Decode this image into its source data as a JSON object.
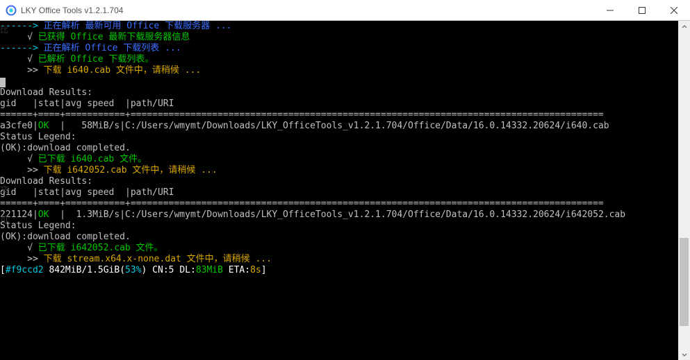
{
  "window": {
    "title": "LKY Office Tools v1.2.1.704"
  },
  "left_edge": {
    "t1": "比",
    "t2": "文",
    "t3": "可"
  },
  "scrollbar": {
    "thumb_top_pct": 65,
    "thumb_height_pct": 28
  },
  "lines": [
    [
      {
        "cls": "c-cyan",
        "t": "------> "
      },
      {
        "cls": "c-blue",
        "t": "正在解析 最新可用 Office 下载服务器 ..."
      }
    ],
    [
      {
        "cls": "c-white",
        "t": "     √ "
      },
      {
        "cls": "c-green",
        "t": "已获得 Office 最新下载服务器信息"
      }
    ],
    [
      {
        "cls": "",
        "t": ""
      }
    ],
    [
      {
        "cls": "c-cyan",
        "t": "------> "
      },
      {
        "cls": "c-blue",
        "t": "正在解析 Office 下载列表 ..."
      }
    ],
    [
      {
        "cls": "c-white",
        "t": "     √ "
      },
      {
        "cls": "c-green",
        "t": "已解析 Office 下载列表。"
      }
    ],
    [
      {
        "cls": "",
        "t": ""
      }
    ],
    [
      {
        "cls": "c-white",
        "t": "     >> "
      },
      {
        "cls": "c-yellow",
        "t": "下载 i640.cab 文件中，请稍候 ..."
      }
    ],
    [
      {
        "cls": "",
        "t": ""
      },
      {
        "cursor": true
      }
    ],
    [
      {
        "cls": "c-gray",
        "t": "Download Results:"
      }
    ],
    [
      {
        "cls": "c-gray",
        "t": "gid   |stat|avg speed  |path/URI"
      }
    ],
    [
      {
        "cls": "c-gray",
        "t": "======+====+===========+======================================================================================="
      }
    ],
    [
      {
        "cls": "c-gray",
        "t": "a3cfe0|"
      },
      {
        "cls": "c-green",
        "t": "OK"
      },
      {
        "cls": "c-gray",
        "t": "  |   58MiB/s|C:/Users/wmymt/Downloads/LKY_OfficeTools_v1.2.1.704/Office/Data/16.0.14332.20624/i640.cab"
      }
    ],
    [
      {
        "cls": "",
        "t": ""
      }
    ],
    [
      {
        "cls": "c-gray",
        "t": "Status Legend:"
      }
    ],
    [
      {
        "cls": "c-gray",
        "t": "(OK):download completed."
      }
    ],
    [
      {
        "cls": "c-white",
        "t": "     √ "
      },
      {
        "cls": "c-green",
        "t": "已下载 i640.cab 文件。"
      }
    ],
    [
      {
        "cls": "",
        "t": ""
      }
    ],
    [
      {
        "cls": "c-white",
        "t": "     >> "
      },
      {
        "cls": "c-yellow",
        "t": "下载 i642052.cab 文件中，请稍候 ..."
      }
    ],
    [
      {
        "cls": "",
        "t": ""
      }
    ],
    [
      {
        "cls": "c-gray",
        "t": "Download Results:"
      }
    ],
    [
      {
        "cls": "c-gray",
        "t": "gid   |stat|avg speed  |path/URI"
      }
    ],
    [
      {
        "cls": "c-gray",
        "t": "======+====+===========+======================================================================================="
      }
    ],
    [
      {
        "cls": "c-gray",
        "t": "221124|"
      },
      {
        "cls": "c-green",
        "t": "OK"
      },
      {
        "cls": "c-gray",
        "t": "  |  1.3MiB/s|C:/Users/wmymt/Downloads/LKY_OfficeTools_v1.2.1.704/Office/Data/16.0.14332.20624/i642052.cab"
      }
    ],
    [
      {
        "cls": "",
        "t": ""
      }
    ],
    [
      {
        "cls": "c-gray",
        "t": "Status Legend:"
      }
    ],
    [
      {
        "cls": "c-gray",
        "t": "(OK):download completed."
      }
    ],
    [
      {
        "cls": "c-white",
        "t": "     √ "
      },
      {
        "cls": "c-green",
        "t": "已下载 i642052.cab 文件。"
      }
    ],
    [
      {
        "cls": "",
        "t": ""
      }
    ],
    [
      {
        "cls": "c-white",
        "t": "     >> "
      },
      {
        "cls": "c-yellow",
        "t": "下载 stream.x64.x-none.dat 文件中，请稍候 ..."
      }
    ],
    [
      {
        "cls": "c-bwhite",
        "t": "["
      },
      {
        "cls": "c-cyan",
        "t": "#f9ccd2"
      },
      {
        "cls": "c-bwhite",
        "t": " 842MiB"
      },
      {
        "cls": "c-bwhite",
        "t": "/"
      },
      {
        "cls": "c-bwhite",
        "t": "1.5GiB"
      },
      {
        "cls": "c-bwhite",
        "t": "("
      },
      {
        "cls": "c-cyan",
        "t": "53%"
      },
      {
        "cls": "c-bwhite",
        "t": ") CN:"
      },
      {
        "cls": "c-bwhite",
        "t": "5"
      },
      {
        "cls": "c-bwhite",
        "t": " DL:"
      },
      {
        "cls": "c-green",
        "t": "83MiB"
      },
      {
        "cls": "c-bwhite",
        "t": " ETA:"
      },
      {
        "cls": "c-yellow",
        "t": "8s"
      },
      {
        "cls": "c-bwhite",
        "t": "]"
      }
    ]
  ]
}
